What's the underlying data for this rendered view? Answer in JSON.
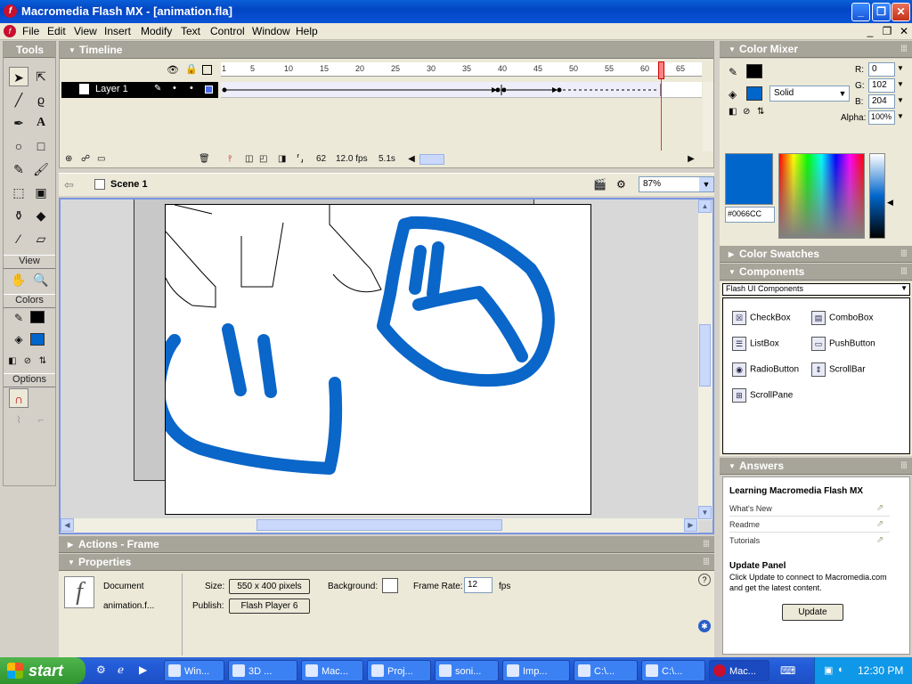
{
  "window": {
    "title": "Macromedia Flash MX - [animation.fla]",
    "app_logo_glyph": "f",
    "buttons": [
      "_",
      "❐",
      "✕"
    ]
  },
  "menu": {
    "items": [
      "File",
      "Edit",
      "View",
      "Insert",
      "Modify",
      "Text",
      "Control",
      "Window",
      "Help"
    ],
    "doc_buttons": [
      "_",
      "❐",
      "✕"
    ]
  },
  "tools": {
    "title": "Tools",
    "view_label": "View",
    "colors_label": "Colors",
    "options_label": "Options",
    "stroke_color": "#000000",
    "fill_color": "#0066CC"
  },
  "timeline": {
    "title": "Timeline",
    "layer_name": "Layer 1",
    "ruler": [
      "1",
      "5",
      "10",
      "15",
      "20",
      "25",
      "30",
      "35",
      "40",
      "45",
      "50",
      "55",
      "60",
      "65"
    ],
    "current_frame": "62",
    "frame_rate": "12.0 fps",
    "elapsed": "5.1s"
  },
  "scene": {
    "name": "Scene 1",
    "zoom": "87%"
  },
  "color_mixer": {
    "title": "Color Mixer",
    "fill_type": "Solid",
    "r_label": "R:",
    "r": "0",
    "g_label": "G:",
    "g": "102",
    "b_label": "B:",
    "b": "204",
    "alpha_label": "Alpha:",
    "alpha": "100%",
    "hex": "#0066CC"
  },
  "color_swatches": {
    "title": "Color Swatches"
  },
  "components": {
    "title": "Components",
    "set": "Flash UI Components",
    "items": [
      "CheckBox",
      "ComboBox",
      "ListBox",
      "PushButton",
      "RadioButton",
      "ScrollBar",
      "ScrollPane"
    ]
  },
  "answers": {
    "title": "Answers",
    "heading": "Learning Macromedia Flash MX",
    "links": [
      "What's New",
      "Readme",
      "Tutorials"
    ],
    "update_title": "Update Panel",
    "update_text_1": "Click Update to connect to Macromedia.com",
    "update_text_2": "and get the latest content.",
    "update_button": "Update"
  },
  "actions": {
    "title": "Actions - Frame"
  },
  "properties": {
    "title": "Properties",
    "type": "Document",
    "name": "animation.f...",
    "size_label": "Size:",
    "size_value": "550 x 400 pixels",
    "background_label": "Background:",
    "frame_rate_label": "Frame Rate:",
    "frame_rate_value": "12",
    "fps_label": "fps",
    "publish_label": "Publish:",
    "publish_value": "Flash Player 6"
  },
  "taskbar": {
    "start": "start",
    "tasks": [
      "Win...",
      "3D ...",
      "Mac...",
      "Proj...",
      "soni...",
      "Imp...",
      "C:\\...",
      "C:\\...",
      "Mac..."
    ],
    "clock": "12:30 PM"
  },
  "colors": {
    "accent": "#0066CC",
    "title_blue": "#0346C4",
    "stroke": "#0A66C8"
  }
}
